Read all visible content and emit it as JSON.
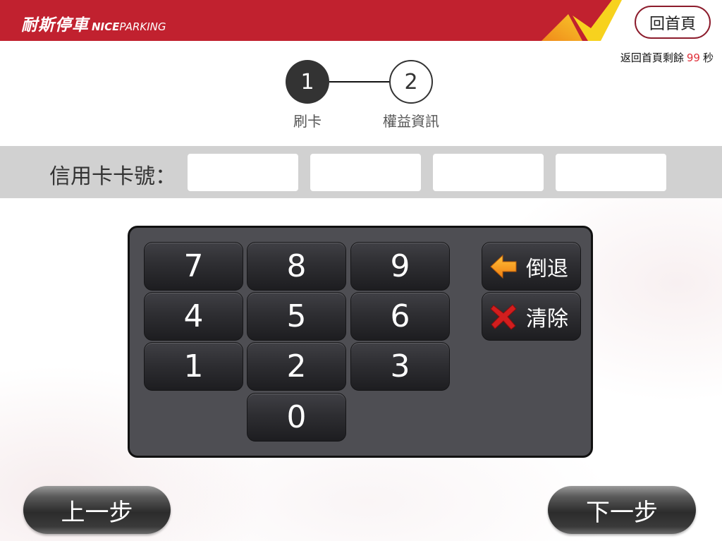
{
  "header": {
    "logo_cn": "耐斯停車",
    "logo_en_bold": "NICE",
    "logo_en": "PARKING",
    "home_button": "回首頁"
  },
  "countdown": {
    "prefix": "返回首頁剩餘",
    "seconds": "99",
    "suffix": "秒"
  },
  "steps": [
    {
      "number": "1",
      "label": "刷卡",
      "active": true
    },
    {
      "number": "2",
      "label": "權益資訊",
      "active": false
    }
  ],
  "card_input": {
    "label": "信用卡卡號：",
    "fields": [
      "",
      "",
      "",
      ""
    ]
  },
  "keypad": {
    "keys": [
      "7",
      "8",
      "9",
      "4",
      "5",
      "6",
      "1",
      "2",
      "3",
      "0"
    ],
    "backspace": "倒退",
    "backspace_icon": "arrow-left-icon",
    "clear": "清除",
    "clear_icon": "x-icon"
  },
  "nav": {
    "prev": "上一步",
    "next": "下一步"
  },
  "colors": {
    "header_red": "#c1212f",
    "accent_yellow": "#f7d21e",
    "accent_orange": "#f29a1c",
    "countdown_red": "#e0303a",
    "keypad_bg": "#4e4e53"
  }
}
